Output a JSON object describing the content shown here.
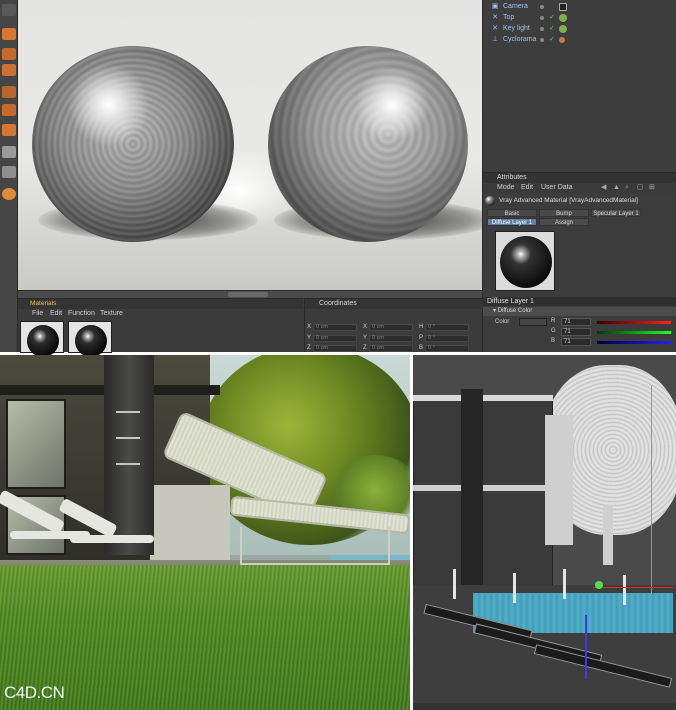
{
  "object_manager": {
    "objects": [
      {
        "name": "Camera",
        "icon": "camera-icon"
      },
      {
        "name": "Top",
        "icon": "light-icon"
      },
      {
        "name": "Key light",
        "icon": "light-icon"
      },
      {
        "name": "Cyclorama",
        "icon": "cyclorama-icon"
      }
    ]
  },
  "attributes": {
    "title": "Attributes",
    "menu": [
      "Mode",
      "Edit",
      "User Data"
    ],
    "material_name": "Vray Advanced Material [VrayAdvancedMaterial]",
    "tabs": [
      "Basic",
      "Bump",
      "Specular Layer 1",
      "Diffuse Layer 1",
      "Assign"
    ],
    "active_tab": "Diffuse Layer 1",
    "section": "Diffuse Layer 1",
    "subsection": "Diffuse Color",
    "color_label": "Color",
    "rgb": {
      "r_label": "R",
      "g_label": "G",
      "b_label": "B",
      "r": "71",
      "g": "71",
      "b": "71"
    }
  },
  "materials": {
    "title": "Materials",
    "menu": [
      "File",
      "Edit",
      "Function",
      "Texture"
    ]
  },
  "coordinates": {
    "title": "Coordinates",
    "rows": [
      {
        "a": "X",
        "a_val": "0 cm",
        "b": "X",
        "b_val": "0 cm",
        "c": "H",
        "c_val": "0 °"
      },
      {
        "a": "Y",
        "a_val": "0 cm",
        "b": "Y",
        "b_val": "0 cm",
        "c": "P",
        "c_val": "0 °"
      },
      {
        "a": "Z",
        "a_val": "0 cm",
        "b": "Z",
        "b_val": "0 cm",
        "c": "B",
        "c_val": "0 °"
      }
    ]
  },
  "watermark": "C4D.CN",
  "colors": {
    "accent": "#5f7fa8",
    "materials_title": "#f0c050",
    "axis_x": "#e02a2a",
    "axis_y": "#4fc94f",
    "axis_z": "#3b3be0"
  }
}
